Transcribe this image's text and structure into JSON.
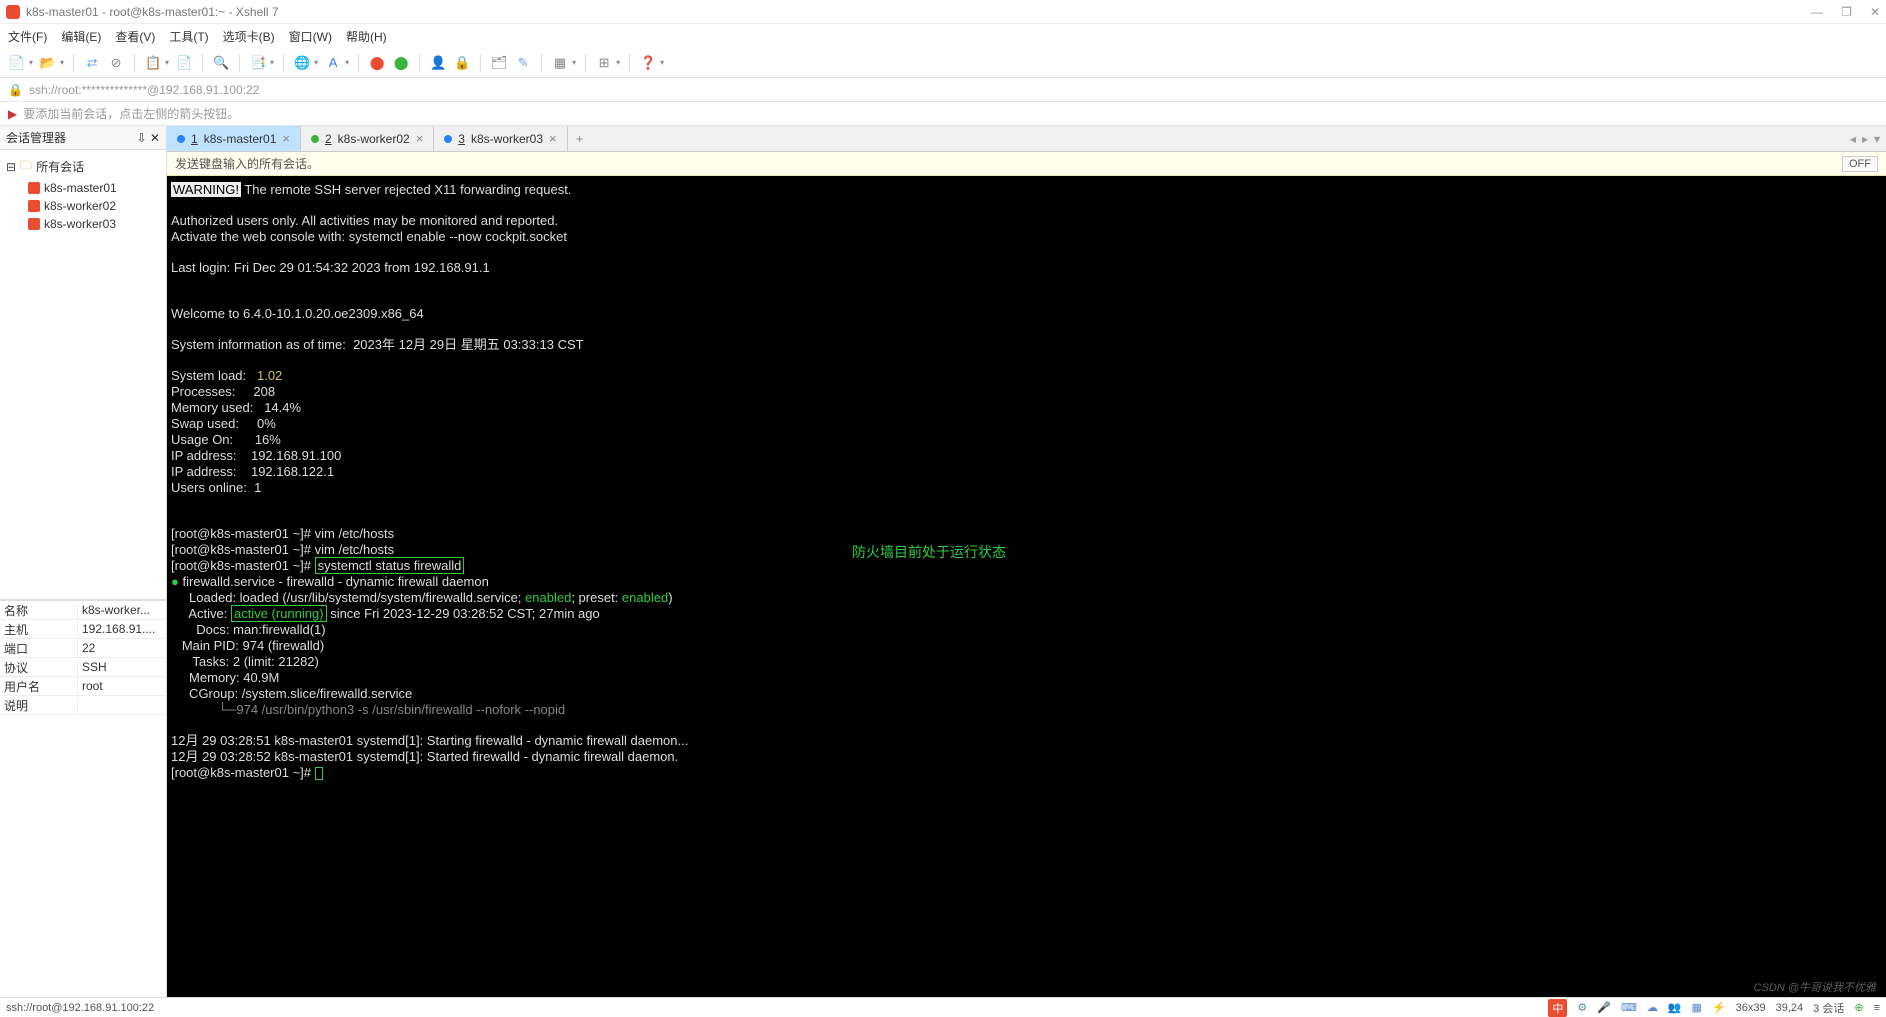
{
  "window": {
    "title": "k8s-master01 - root@k8s-master01:~ - Xshell 7",
    "minimize": "—",
    "maximize": "❐",
    "close": "✕"
  },
  "menu": [
    "文件(F)",
    "编辑(E)",
    "查看(V)",
    "工具(T)",
    "选项卡(B)",
    "窗口(W)",
    "帮助(H)"
  ],
  "address": "ssh://root:**************@192.168.91.100:22",
  "tip": "要添加当前会话，点击左侧的箭头按钮。",
  "sidebar": {
    "title": "会话管理器",
    "root": "所有会话",
    "items": [
      "k8s-master01",
      "k8s-worker02",
      "k8s-worker03"
    ]
  },
  "props": [
    {
      "k": "名称",
      "v": "k8s-worker..."
    },
    {
      "k": "主机",
      "v": "192.168.91...."
    },
    {
      "k": "端口",
      "v": "22"
    },
    {
      "k": "协议",
      "v": "SSH"
    },
    {
      "k": "用户名",
      "v": "root"
    },
    {
      "k": "说明",
      "v": ""
    }
  ],
  "tabs": [
    {
      "num": "1",
      "label": "k8s-master01",
      "dot": "#2a7fff",
      "active": true
    },
    {
      "num": "2",
      "label": "k8s-worker02",
      "dot": "#3cb43c",
      "active": false
    },
    {
      "num": "3",
      "label": "k8s-worker03",
      "dot": "#2a7fff",
      "active": false
    }
  ],
  "yellow_bar": "发送键盘输入的所有会话。",
  "off_label": "OFF",
  "terminal": {
    "warning_tag": "WARNING!",
    "warning_text": " The remote SSH server rejected X11 forwarding request.",
    "auth1": "Authorized users only. All activities may be monitored and reported.",
    "auth2": "Activate the web console with: systemctl enable --now cockpit.socket",
    "lastlogin": "Last login: Fri Dec 29 01:54:32 2023 from 192.168.91.1",
    "welcome": "Welcome to 6.4.0-10.1.0.20.oe2309.x86_64",
    "sysinfo": "System information as of time:  2023年 12月 29日 星期五 03:33:13 CST",
    "stats": [
      {
        "k": "System load:   ",
        "v": "1.02",
        "yellow": true
      },
      {
        "k": "Processes:     ",
        "v": "208"
      },
      {
        "k": "Memory used:   ",
        "v": "14.4%"
      },
      {
        "k": "Swap used:     ",
        "v": "0%"
      },
      {
        "k": "Usage On:      ",
        "v": "16%"
      },
      {
        "k": "IP address:    ",
        "v": "192.168.91.100"
      },
      {
        "k": "IP address:    ",
        "v": "192.168.122.1"
      },
      {
        "k": "Users online:  ",
        "v": "1"
      }
    ],
    "prompt": "[root@k8s-master01 ~]# ",
    "cmd1": "vim /etc/hosts",
    "cmd2": "vim /etc/hosts",
    "cmd3": "systemctl status firewalld",
    "annotation": "防火墙目前处于运行状态",
    "svc_line": " firewalld.service - firewalld - dynamic firewall daemon",
    "loaded_pre": "     Loaded: loaded (/usr/lib/systemd/system/firewalld.service; ",
    "enabled1": "enabled",
    "loaded_mid": "; preset: ",
    "enabled2": "enabled",
    "loaded_end": ")",
    "active_pre": "     Active: ",
    "active_val": "active (running)",
    "active_post": " since Fri 2023-12-29 03:28:52 CST; 27min ago",
    "docs": "       Docs: man:firewalld(1)",
    "mainpid": "   Main PID: 974 (firewalld)",
    "tasks": "      Tasks: 2 (limit: 21282)",
    "memory": "     Memory: 40.9M",
    "cgroup": "     CGroup: /system.slice/firewalld.service",
    "cgroup2": "             └─974 /usr/bin/python3 -s /usr/sbin/firewalld --nofork --nopid",
    "log1": "12月 29 03:28:51 k8s-master01 systemd[1]: Starting firewalld - dynamic firewall daemon...",
    "log2": "12月 29 03:28:52 k8s-master01 systemd[1]: Started firewalld - dynamic firewall daemon."
  },
  "status": {
    "left": "ssh://root@192.168.91.100:22",
    "dims": "36x39",
    "pos": "39,24",
    "sessions": "3 会话",
    "ime": "中"
  },
  "watermark": "CSDN @牛哥说我不优雅"
}
